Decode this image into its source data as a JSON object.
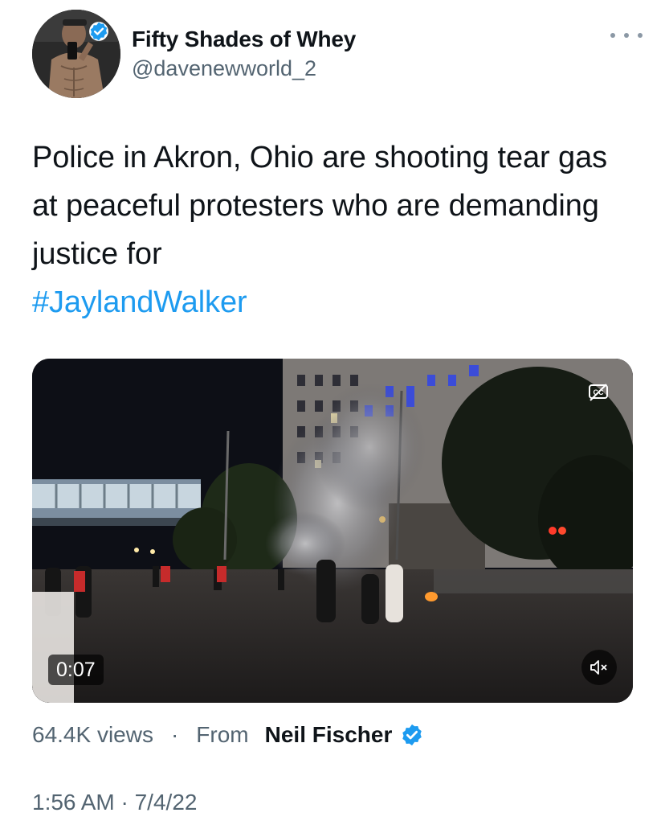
{
  "author": {
    "display_name": "Fifty Shades of Whey",
    "handle": "@davenewworld_2",
    "avatar_icon": "profile-photo",
    "verified_icon": "verified-badge-icon"
  },
  "tweet": {
    "text": "Police in Akron, Ohio are shooting tear gas at peaceful protesters who are demanding justice for",
    "hashtag": "#JaylandWalker"
  },
  "video": {
    "duration": "0:07",
    "captions_icon": "closed-captions-icon",
    "mute_icon": "muted-speaker-icon"
  },
  "stats": {
    "views": "64.4K views",
    "separator": "·",
    "from_label": "From",
    "source_name": "Neil Fischer",
    "source_verified_icon": "verified-badge-icon"
  },
  "timestamp": "1:56 AM · 7/4/22",
  "colors": {
    "link": "#1d9bf0",
    "text_primary": "#0f1419",
    "text_secondary": "#536471"
  }
}
